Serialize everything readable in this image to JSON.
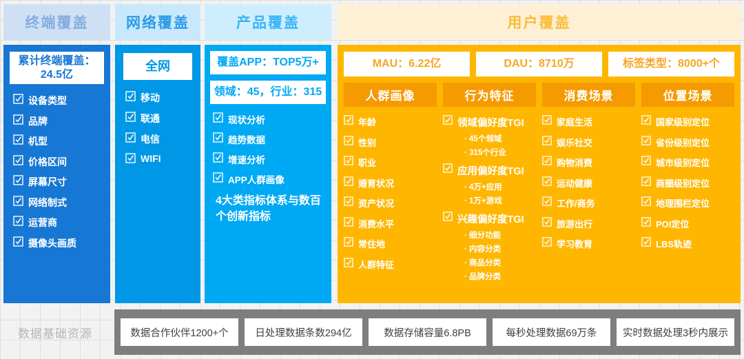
{
  "columns": {
    "terminal": {
      "header": "终端覆盖",
      "stat": "累计终端覆盖：\n24.5亿",
      "items": [
        "设备类型",
        "品牌",
        "机型",
        "价格区间",
        "屏幕尺寸",
        "网络制式",
        "运营商",
        "摄像头画质"
      ]
    },
    "network": {
      "header": "网络覆盖",
      "stat": "全网",
      "items": [
        "移动",
        "联通",
        "电信",
        "WIFI"
      ]
    },
    "product": {
      "header": "产品覆盖",
      "stat1": "覆盖APP：TOP5万+",
      "stat2": "领域：45，行业：315",
      "items": [
        "现状分析",
        "趋势数据",
        "增速分析",
        "APP人群画像"
      ],
      "note": "4大类指标体系与数百个创新指标"
    },
    "user": {
      "header": "用户覆盖",
      "stats": [
        "MAU：6.22亿",
        "DAU：8710万",
        "标签类型：8000+个"
      ],
      "tabs": [
        "人群画像",
        "行为特征",
        "消费场景",
        "位置场景"
      ],
      "groups": [
        {
          "name": "人群画像",
          "entries": [
            {
              "label": "年龄"
            },
            {
              "label": "性别"
            },
            {
              "label": "职业"
            },
            {
              "label": "婚育状况"
            },
            {
              "label": "资产状况"
            },
            {
              "label": "消费水平"
            },
            {
              "label": "常住地"
            },
            {
              "label": "人群特征"
            }
          ]
        },
        {
          "name": "行为特征",
          "entries": [
            {
              "label": "领域偏好度TGI",
              "big": true,
              "subs": [
                "45个领域",
                "315个行业"
              ]
            },
            {
              "label": "应用偏好度TGI",
              "big": true,
              "subs": [
                "4万+应用",
                "1万+游戏"
              ]
            },
            {
              "label": "兴趣偏好度TGI",
              "big": true,
              "subs": [
                "细分功能",
                "内容分类",
                "商品分类",
                "品牌分类"
              ]
            }
          ]
        },
        {
          "name": "消费场景",
          "entries": [
            {
              "label": "家庭生活"
            },
            {
              "label": "娱乐社交"
            },
            {
              "label": "购物消费"
            },
            {
              "label": "运动健康"
            },
            {
              "label": "工作/商务"
            },
            {
              "label": "旅游出行"
            },
            {
              "label": "学习教育"
            }
          ]
        },
        {
          "name": "位置场景",
          "entries": [
            {
              "label": "国家级别定位"
            },
            {
              "label": "省份级别定位"
            },
            {
              "label": "城市级别定位"
            },
            {
              "label": "商圈级别定位"
            },
            {
              "label": "地理围栏定位"
            },
            {
              "label": "POI定位"
            },
            {
              "label": "LBS轨迹"
            }
          ]
        }
      ]
    }
  },
  "footer": {
    "label": "数据基础资源",
    "chips": [
      "数据合作伙伴1200+个",
      "日处理数据条数294亿",
      "数据存储容量6.8PB",
      "每秒处理数据69万条",
      "实时数据处理3秒内展示"
    ]
  },
  "icons": {
    "checkbox": "checkbox-checked-icon"
  },
  "colors": {
    "terminal": "#1777d4",
    "network": "#0097e6",
    "product": "#00a9f4",
    "user": "#ffb600",
    "user_tab": "#f59a00",
    "footer_bar": "#7e7e7e"
  }
}
